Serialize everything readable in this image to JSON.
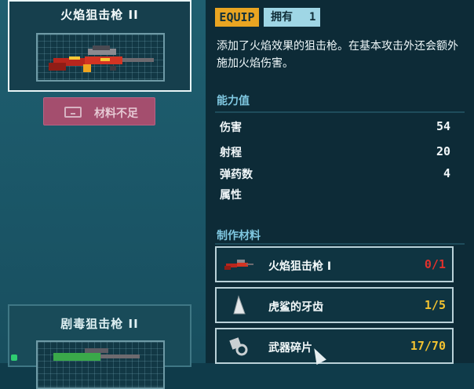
{
  "weapons": [
    {
      "name": "火焰狙击枪 II",
      "selected": true
    },
    {
      "name": "剧毒狙击枪 II",
      "selected": false
    }
  ],
  "craft_button": {
    "label": "材料不足",
    "enabled": false,
    "color": "#a44e6e"
  },
  "detail": {
    "equip_tag": "EQUIP",
    "owned_label": "拥有",
    "owned_count": "1",
    "description": "添加了火焰效果的狙击枪。在基本攻击外还会额外施加火焰伤害。",
    "stats_title": "能力值",
    "stats": [
      {
        "label": "伤害",
        "value": "54"
      },
      {
        "label": "射程",
        "value": "20"
      },
      {
        "label": "弹药数",
        "value": "4"
      },
      {
        "label": "属性",
        "value": ""
      }
    ],
    "materials_title": "制作材料",
    "materials": [
      {
        "name": "火焰狙击枪 I",
        "count": "0/1",
        "icon": "rifle-icon",
        "color": "#e0312d"
      },
      {
        "name": "虎鲨的牙齿",
        "count": "1/5",
        "icon": "shark-tooth-icon",
        "color": "#f2c230"
      },
      {
        "name": "武器碎片",
        "count": "17/70",
        "icon": "weapon-fragment-icon",
        "color": "#f2c230"
      }
    ]
  },
  "colors": {
    "accent": "#e9a522",
    "section": "#7fc7e0",
    "panel": "#0d2b37",
    "insufficient": "#e0312d"
  }
}
